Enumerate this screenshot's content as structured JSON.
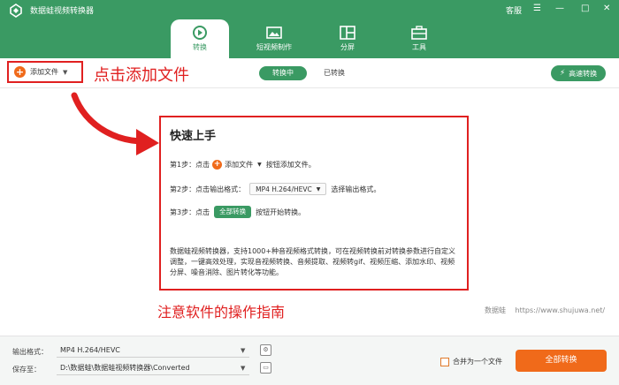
{
  "app": {
    "title": "数据蛙视频转换器",
    "service_label": "客服",
    "controls": [
      "☰",
      "—",
      "□",
      "✕"
    ]
  },
  "tabs": [
    {
      "label": "转换",
      "icon": "refresh-icon",
      "active": true
    },
    {
      "label": "短视频制作",
      "icon": "image-icon",
      "active": false
    },
    {
      "label": "分屏",
      "icon": "split-screen-icon",
      "active": false
    },
    {
      "label": "工具",
      "icon": "toolbox-icon",
      "active": false
    }
  ],
  "toolbar": {
    "add_file_label": "添加文件",
    "add_file_annotation": "点击添加文件",
    "converting_label": "转换中",
    "converted_label": "已转换",
    "fast_convert_label": "高速转换"
  },
  "guide": {
    "title": "快速上手",
    "step1_prefix": "第1步：点击",
    "step1_button": "添加文件",
    "step1_suffix": "按钮添加文件。",
    "step2_prefix": "第2步：点击输出格式：",
    "step2_format": "MP4 H.264/HEVC",
    "step2_suffix": "选择输出格式。",
    "step3_prefix": "第3步：点击",
    "step3_button": "全部转换",
    "step3_suffix": "按钮开始转换。",
    "description": "数据蛙视频转换器，支持1000+种音视频格式转换，可在视频转换前对转换参数进行自定义调整，一键高效处理，实现音视频转换、音频提取、视频转gif、视频压缩、添加水印、视频分屏、噪音消除、图片转化等功能。"
  },
  "annotation_bottom": "注意软件的操作指南",
  "watermark": {
    "brand": "数据蛙",
    "url": "https://www.shujuwa.net/"
  },
  "bottom": {
    "output_format_label": "输出格式：",
    "output_format_value": "MP4 H.264/HEVC",
    "save_to_label": "保存至：",
    "save_to_value": "D:\\数据蛙\\数据蛙视频转换器\\Converted",
    "merge_label": "合并为一个文件",
    "convert_all_label": "全部转换"
  },
  "colors": {
    "brand_green": "#3a9a63",
    "accent_orange": "#f06a1a",
    "annotation_red": "#e02020"
  }
}
